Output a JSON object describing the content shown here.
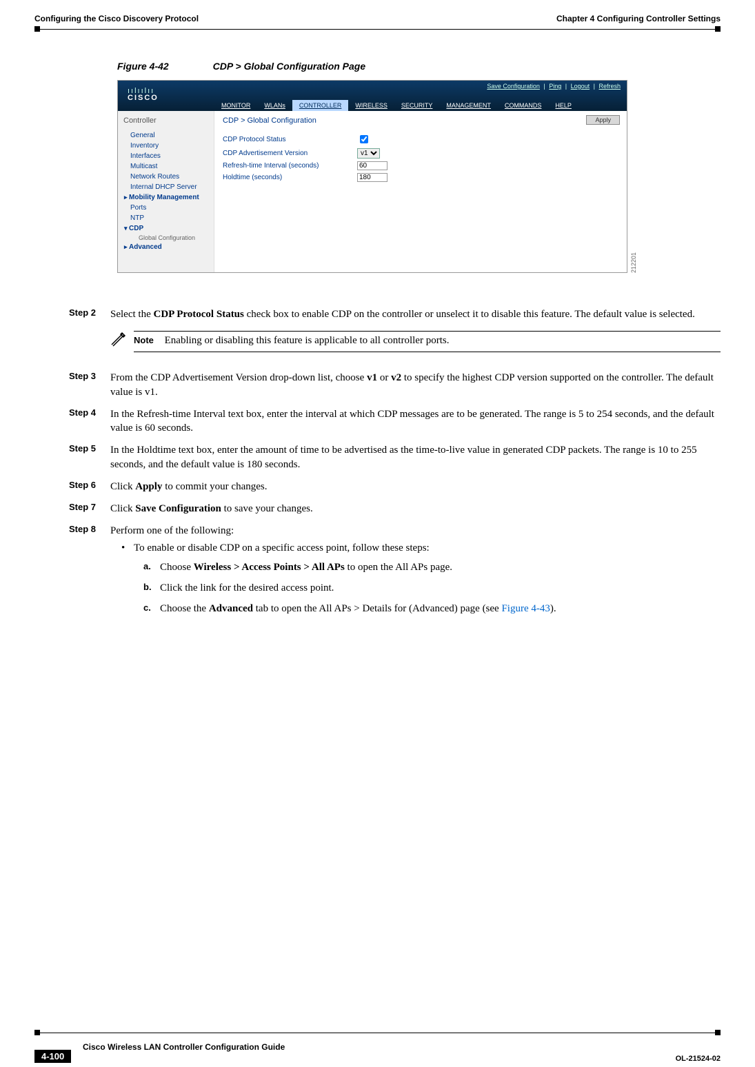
{
  "header": {
    "chapter": "Chapter 4      Configuring Controller Settings",
    "section": "Configuring the Cisco Discovery Protocol"
  },
  "figure": {
    "num": "Figure 4-42",
    "title": "CDP > Global Configuration Page",
    "image_id": "212201"
  },
  "screenshot": {
    "logo_bars": "ıılıılıı",
    "logo_name": "CISCO",
    "toplinks": {
      "save": "Save Configuration",
      "ping": "Ping",
      "logout": "Logout",
      "refresh": "Refresh"
    },
    "tabs": [
      "MONITOR",
      "WLANs",
      "CONTROLLER",
      "WIRELESS",
      "SECURITY",
      "MANAGEMENT",
      "COMMANDS",
      "HELP"
    ],
    "sidebar_title": "Controller",
    "sidebar": [
      {
        "label": "General",
        "bold": false
      },
      {
        "label": "Inventory",
        "bold": false
      },
      {
        "label": "Interfaces",
        "bold": false
      },
      {
        "label": "Multicast",
        "bold": false
      },
      {
        "label": "Network Routes",
        "bold": false
      },
      {
        "label": "Internal DHCP Server",
        "bold": false
      },
      {
        "label": "Mobility Management",
        "bold": true,
        "caret": true
      },
      {
        "label": "Ports",
        "bold": false
      },
      {
        "label": "NTP",
        "bold": false
      },
      {
        "label": "CDP",
        "bold": true,
        "caret": true,
        "open": true,
        "sub": "Global Configuration"
      },
      {
        "label": "Advanced",
        "bold": true,
        "caret": true
      }
    ],
    "crumb": "CDP > Global Configuration",
    "apply": "Apply",
    "rows": {
      "status_label": "CDP Protocol Status",
      "adv_label": "CDP Advertisement Version",
      "adv_value": "v1",
      "refresh_label": "Refresh-time Interval (seconds)",
      "refresh_value": "60",
      "hold_label": "Holdtime (seconds)",
      "hold_value": "180"
    }
  },
  "steps": {
    "s2": {
      "label": "Step 2",
      "text_pre": "Select the ",
      "bold1": "CDP Protocol Status",
      "text_post": " check box to enable CDP on the controller or unselect it to disable this feature. The default value is selected."
    },
    "note": {
      "label": "Note",
      "text": "Enabling or disabling this feature is applicable to all controller ports."
    },
    "s3": {
      "label": "Step 3",
      "text1": "From the CDP Advertisement Version drop-down list, choose ",
      "b1": "v1",
      "mid": " or ",
      "b2": "v2",
      "text2": " to specify the highest CDP version supported on the controller. The default value is v1."
    },
    "s4": {
      "label": "Step 4",
      "text": "In the Refresh-time Interval text box, enter the interval at which CDP messages are to be generated. The range is 5 to 254 seconds, and the default value is 60 seconds."
    },
    "s5": {
      "label": "Step 5",
      "text": "In the Holdtime text box, enter the amount of time to be advertised as the time-to-live value in generated CDP packets. The range is 10 to 255 seconds, and the default value is 180 seconds."
    },
    "s6": {
      "label": "Step 6",
      "pre": "Click ",
      "b": "Apply",
      "post": " to commit your changes."
    },
    "s7": {
      "label": "Step 7",
      "pre": "Click ",
      "b": "Save Configuration",
      "post": " to save your changes."
    },
    "s8": {
      "label": "Step 8",
      "text": "Perform one of the following:",
      "bullet": "To enable or disable CDP on a specific access point, follow these steps:",
      "a": {
        "label": "a.",
        "pre": "Choose ",
        "b": "Wireless > Access Points > All APs",
        "post": " to open the All APs page."
      },
      "b": {
        "label": "b.",
        "text": "Click the link for the desired access point."
      },
      "c": {
        "label": "c.",
        "pre": "Choose the ",
        "b": "Advanced",
        "mid": " tab to open the All APs > Details for (Advanced) page (see ",
        "link": "Figure 4-43",
        "post": ")."
      }
    }
  },
  "footer": {
    "guide": "Cisco Wireless LAN Controller Configuration Guide",
    "page": "4-100",
    "doc": "OL-21524-02"
  }
}
